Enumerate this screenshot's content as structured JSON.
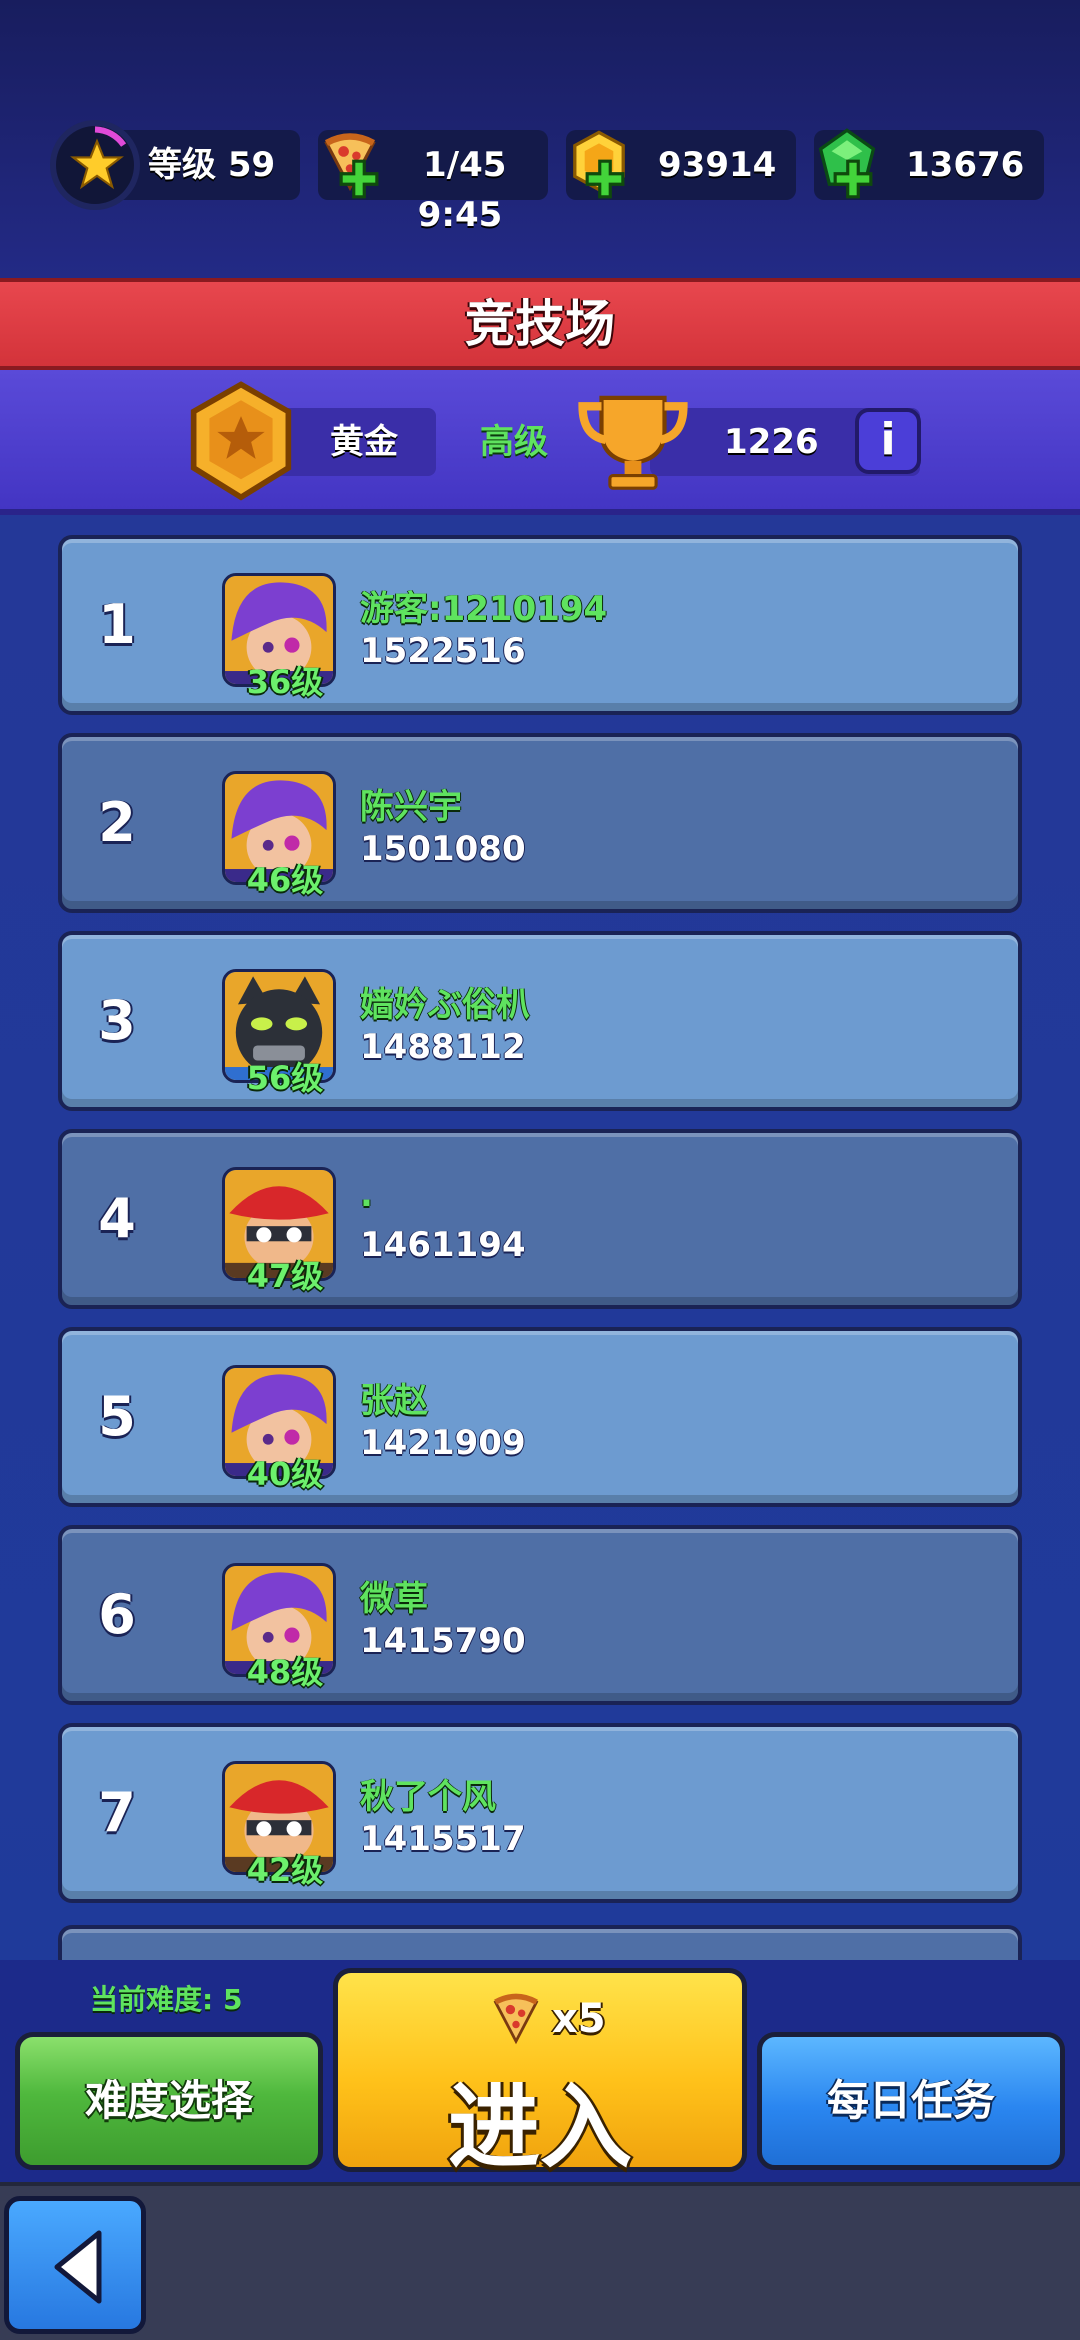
{
  "topbar": {
    "level_label": "等级 59",
    "pizza_count": "1/45",
    "pizza_timer": "9:45",
    "gold": "93914",
    "gems": "13676"
  },
  "title": "竞技场",
  "rank": {
    "tier": "黄金",
    "division": "高级",
    "trophies": "1226",
    "info": "i"
  },
  "leaderboard": [
    {
      "rank": "1",
      "name": "游客:1210194",
      "score": "1522516",
      "level": "36级",
      "avatar": "purple-hair-hero"
    },
    {
      "rank": "2",
      "name": "陈兴宇",
      "score": "1501080",
      "level": "46级",
      "avatar": "purple-hair-hero"
    },
    {
      "rank": "3",
      "name": "嫱妗ぶ俗朳",
      "score": "1488112",
      "level": "56级",
      "avatar": "black-panther-hero"
    },
    {
      "rank": "4",
      "name": ".",
      "score": "1461194",
      "level": "47级",
      "avatar": "red-hat-hero"
    },
    {
      "rank": "5",
      "name": "张赵",
      "score": "1421909",
      "level": "40级",
      "avatar": "purple-hair-hero"
    },
    {
      "rank": "6",
      "name": "微草",
      "score": "1415790",
      "level": "48级",
      "avatar": "purple-hair-hero"
    },
    {
      "rank": "7",
      "name": "秋了个风",
      "score": "1415517",
      "level": "42级",
      "avatar": "red-hat-hero"
    }
  ],
  "controls": {
    "difficulty_text": "当前难度: 5",
    "difficulty_button": "难度选择",
    "enter_cost": "x5",
    "enter_button": "进入",
    "daily_button": "每日任务"
  },
  "colors": {
    "banner_red": "#e0424a",
    "rank_bar_purple": "#4f3fd0",
    "row_light": "#6d9bd0",
    "row_dark": "#4f6fa6",
    "name_green": "#5fe35f",
    "button_green": "#4fb83d",
    "button_yellow": "#ffc21a",
    "button_blue": "#2a86f0"
  },
  "icons": {
    "level": "star-icon",
    "pizza": "pizza-icon",
    "gold": "gold-coin-icon",
    "gem": "green-gem-icon",
    "tier": "gold-badge-icon",
    "trophy": "trophy-icon",
    "back": "back-arrow-icon"
  }
}
